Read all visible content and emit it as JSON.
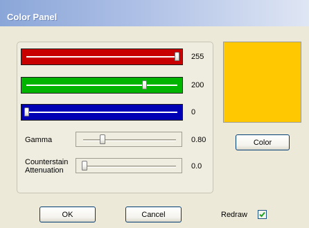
{
  "window": {
    "title": "Color Panel"
  },
  "rgb_sliders": [
    {
      "name": "red",
      "value": 255,
      "max": 255,
      "label": "255",
      "color": "#c80000"
    },
    {
      "name": "green",
      "value": 200,
      "max": 255,
      "label": "200",
      "color": "#00b400"
    },
    {
      "name": "blue",
      "value": 0,
      "max": 255,
      "label": "0",
      "color": "#0000b4"
    }
  ],
  "gamma": {
    "label": "Gamma",
    "value_label": "0.80",
    "fraction": 0.2
  },
  "counterstain": {
    "label_line1": "Counterstain",
    "label_line2": "Attenuation",
    "value_label": "0.0",
    "fraction": 0.0
  },
  "preview": {
    "color": "#ffc800"
  },
  "buttons": {
    "color": "Color",
    "ok": "OK",
    "cancel": "Cancel"
  },
  "redraw": {
    "label": "Redraw",
    "checked": true
  }
}
